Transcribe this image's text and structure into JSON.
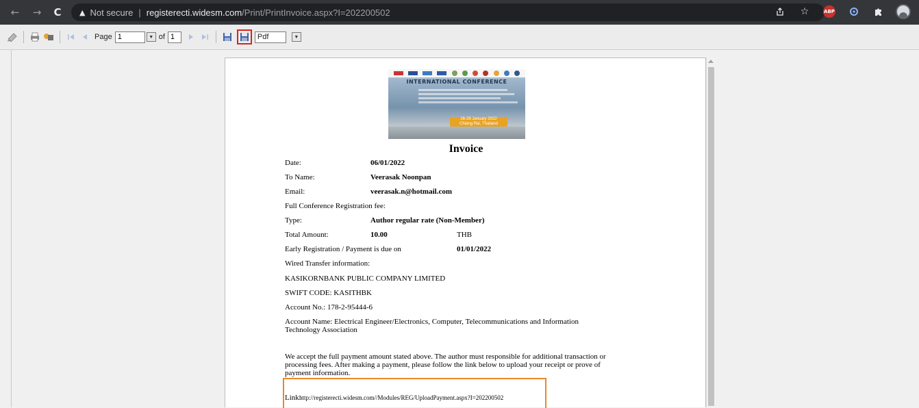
{
  "browser": {
    "not_secure_label": "Not secure",
    "separator": "|",
    "url_host": "registerecti.widesm.com",
    "url_path": "/Print/PrintInvoice.aspx?I=202200502",
    "ext_abp_label": "ABP"
  },
  "toolbar": {
    "page_label": "Page",
    "page_value": "1",
    "of_label": "of",
    "total_pages": "1",
    "export_format": "Pdf"
  },
  "invoice": {
    "title": "Invoice",
    "date_label": "Date:",
    "date_value": "06/01/2022",
    "to_name_label": "To Name:",
    "to_name_value": "Veerasak Noonpan",
    "email_label": "Email:",
    "email_value": "veerasak.n@hotmail.com",
    "fee_heading": "Full Conference Registration fee:",
    "type_label": "Type:",
    "type_value": "Author regular rate (Non-Member)",
    "total_label": "Total Amount:",
    "total_value": "10.00",
    "currency": "THB",
    "due_label": "Early Registration / Payment is due on",
    "due_value": "01/01/2022",
    "wire_heading": "Wired Transfer information:",
    "bank_name": "KASIKORNBANK PUBLIC COMPANY LIMITED",
    "swift": "SWIFT CODE: KASITHBK",
    "account_no": "Account No.: 178-2-95444-6",
    "account_name": "Account Name: Electrical Engineer/Electronics, Computer, Telecommunications and Information Technology Association",
    "notice": "We accept the full payment amount stated above. The author must responsible for additional transaction or processing fees. After making a payment, please follow the link below to upload your receipt or prove of payment information.",
    "link_label": "Link:",
    "link_url": "http://registerecti.widesm.com//Modules/REG/UploadPayment.aspx?I=202200502"
  },
  "banner": {
    "title": "INTERNATIONAL CONFERENCE",
    "date_text": "26-28 January 2022",
    "location_text": "Chiang Rai, Thailand"
  }
}
